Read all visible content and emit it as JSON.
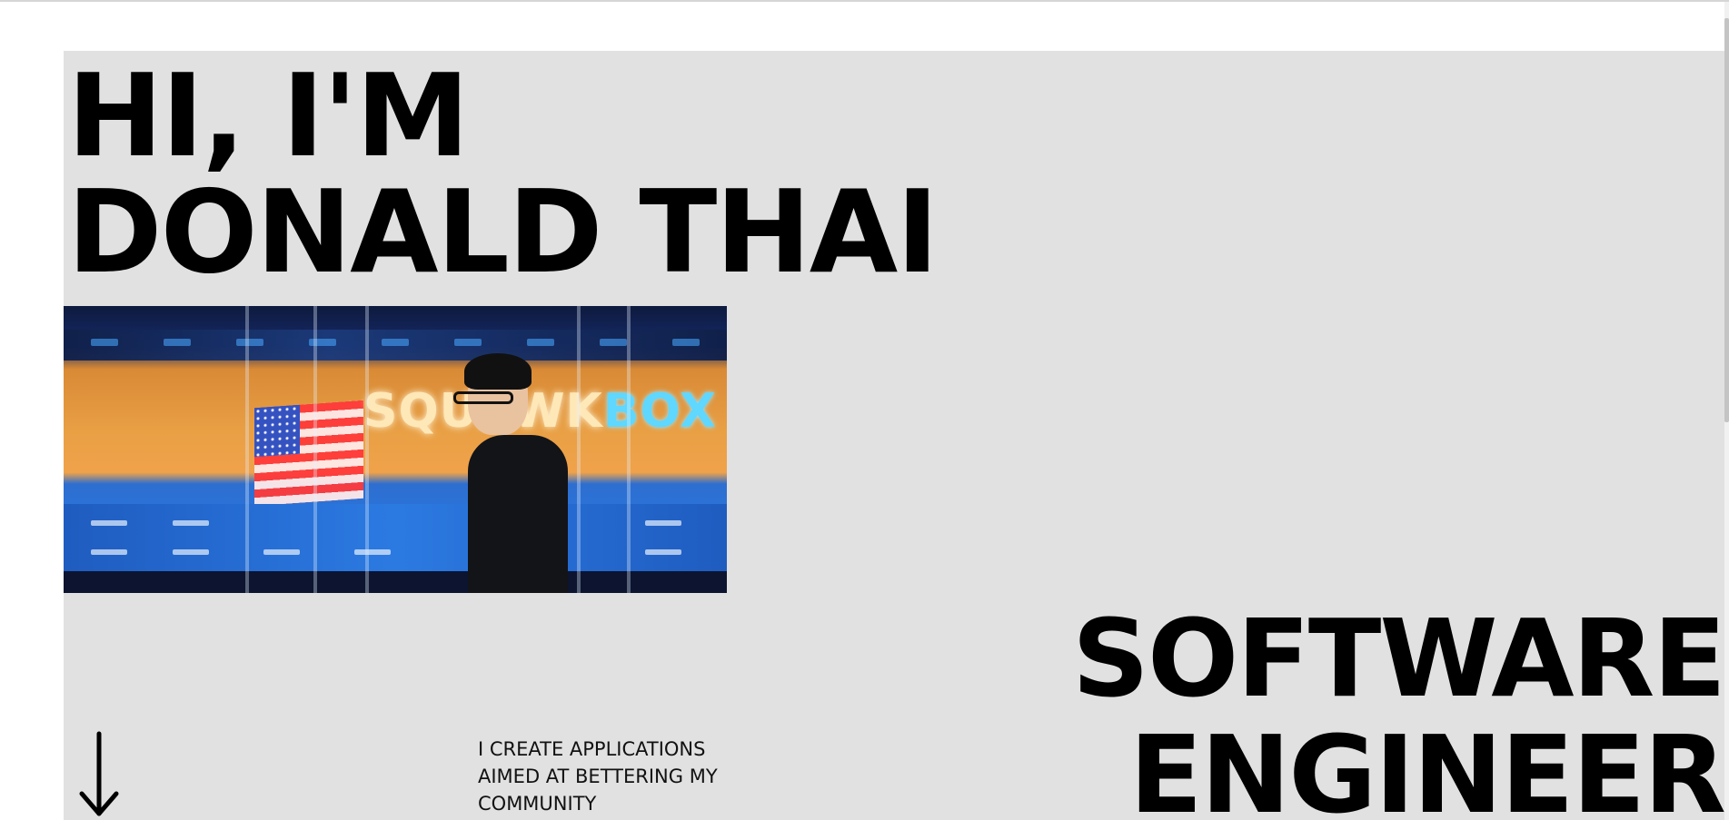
{
  "hero": {
    "greeting": "HI, I'M",
    "name": "DONALD THAI",
    "tagline_lines": [
      "I CREATE APPLICATIONS",
      "AIMED AT BETTERING MY",
      "COMMUNITY"
    ],
    "role_lines": [
      "SOFTWARE",
      "ENGINEER"
    ],
    "scroll_icon": "arrow-down-icon"
  },
  "photo": {
    "sign_text_a": "SQUAWK",
    "sign_text_b": "BOX"
  },
  "colors": {
    "hero_background": "#e1e1e1",
    "page_background": "#ffffff",
    "text": "#000000"
  }
}
